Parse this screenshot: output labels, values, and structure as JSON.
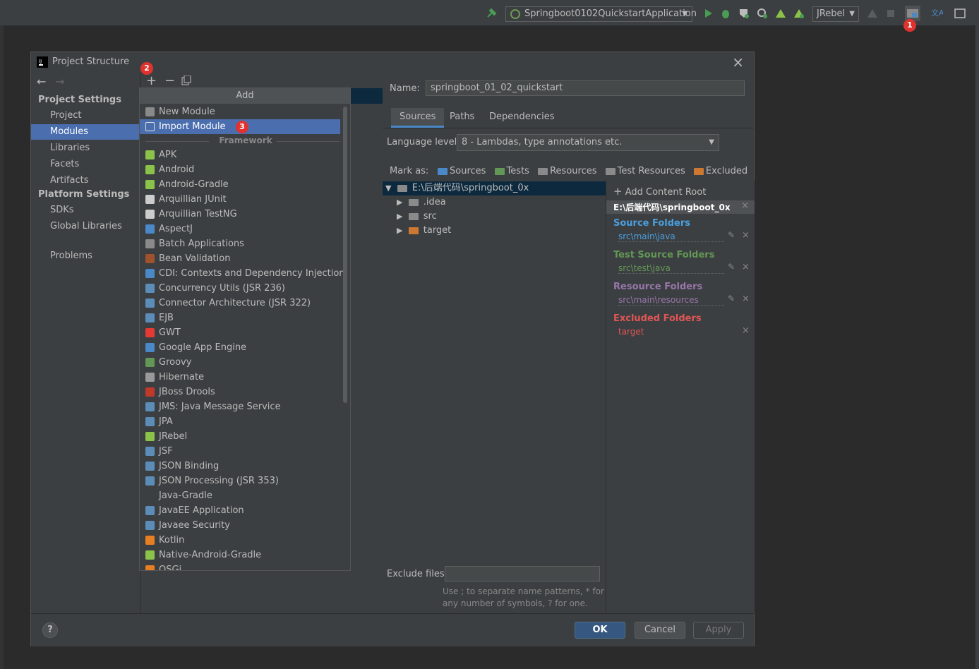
{
  "toolbar": {
    "run_config": "Springboot0102QuickstartApplication",
    "jrebel_select": "JRebel",
    "badge1": "1"
  },
  "dialog": {
    "title": "Project Structure",
    "close": "×",
    "badge2": "2",
    "badge3": "3",
    "sidebar": {
      "project_settings": "Project Settings",
      "items": [
        "Project",
        "Modules",
        "Libraries",
        "Facets",
        "Artifacts"
      ],
      "platform_settings": "Platform Settings",
      "platform_items": [
        "SDKs",
        "Global Libraries"
      ],
      "problems": "Problems"
    },
    "footer": {
      "help": "?",
      "ok": "OK",
      "cancel": "Cancel",
      "apply": "Apply"
    }
  },
  "popup": {
    "title": "Add",
    "new_module": "New Module",
    "import_module": "Import Module",
    "framework_label": "Framework",
    "frameworks": [
      {
        "label": "APK",
        "color": "#8bc34a"
      },
      {
        "label": "Android",
        "color": "#8bc34a"
      },
      {
        "label": "Android-Gradle",
        "color": "#8bc34a"
      },
      {
        "label": "Arquillian JUnit",
        "color": "#cccccc"
      },
      {
        "label": "Arquillian TestNG",
        "color": "#cccccc"
      },
      {
        "label": "AspectJ",
        "color": "#4a88c7"
      },
      {
        "label": "Batch Applications",
        "color": "#8a8a8a"
      },
      {
        "label": "Bean Validation",
        "color": "#a0522d"
      },
      {
        "label": "CDI: Contexts and Dependency Injection",
        "color": "#4a88c7"
      },
      {
        "label": "Concurrency Utils (JSR 236)",
        "color": "#5c8db8"
      },
      {
        "label": "Connector Architecture (JSR 322)",
        "color": "#5c8db8"
      },
      {
        "label": "EJB",
        "color": "#5c8db8"
      },
      {
        "label": "GWT",
        "color": "#e53935"
      },
      {
        "label": "Google App Engine",
        "color": "#4a88c7"
      },
      {
        "label": "Groovy",
        "color": "#629755"
      },
      {
        "label": "Hibernate",
        "color": "#999999"
      },
      {
        "label": "JBoss Drools",
        "color": "#c0392b"
      },
      {
        "label": "JMS: Java Message Service",
        "color": "#5c8db8"
      },
      {
        "label": "JPA",
        "color": "#5c8db8"
      },
      {
        "label": "JRebel",
        "color": "#8bc34a"
      },
      {
        "label": "JSF",
        "color": "#5c8db8"
      },
      {
        "label": "JSON Binding",
        "color": "#5c8db8"
      },
      {
        "label": "JSON Processing (JSR 353)",
        "color": "#5c8db8"
      },
      {
        "label": "Java-Gradle",
        "color": ""
      },
      {
        "label": "JavaEE Application",
        "color": "#5c8db8"
      },
      {
        "label": "Javaee Security",
        "color": "#5c8db8"
      },
      {
        "label": "Kotlin",
        "color": "#e67e22"
      },
      {
        "label": "Native-Android-Gradle",
        "color": "#8bc34a"
      },
      {
        "label": "OSGi",
        "color": "#e67e22"
      }
    ]
  },
  "module": {
    "name_label": "Name:",
    "name_value": "springboot_01_02_quickstart",
    "tabs": [
      "Sources",
      "Paths",
      "Dependencies"
    ],
    "language_level_label": "Language level:",
    "language_level_value": "8 - Lambdas, type annotations etc.",
    "mark_as_label": "Mark as:",
    "mark_as": [
      {
        "label": "Sources",
        "color": "#4a88c7"
      },
      {
        "label": "Tests",
        "color": "#629755"
      },
      {
        "label": "Resources",
        "color": "#8a8a8a"
      },
      {
        "label": "Test Resources",
        "color": "#8a8a8a"
      },
      {
        "label": "Excluded",
        "color": "#cc7832"
      }
    ],
    "tree": {
      "root": "E:\\后端代码\\springboot_0x",
      "children": [
        ".idea",
        "src",
        "target"
      ]
    },
    "exclude_files_label": "Exclude files:",
    "exclude_hint": "Use ; to separate name patterns, * for any number of symbols, ? for one."
  },
  "content_root": {
    "add_label": "Add Content Root",
    "path": "E:\\后端代码\\springboot_0x",
    "source_folders": "Source Folders",
    "source_value": "src\\main\\java",
    "test_source_folders": "Test Source Folders",
    "test_value": "src\\test\\java",
    "resource_folders": "Resource Folders",
    "resource_value": "src\\main\\resources",
    "excluded_folders": "Excluded Folders",
    "excluded_value": "target"
  },
  "colors": {
    "source": "#4a9fe0",
    "test": "#629755",
    "resource": "#9876aa",
    "excluded": "#e05555",
    "selection": "#4b6eaf"
  }
}
